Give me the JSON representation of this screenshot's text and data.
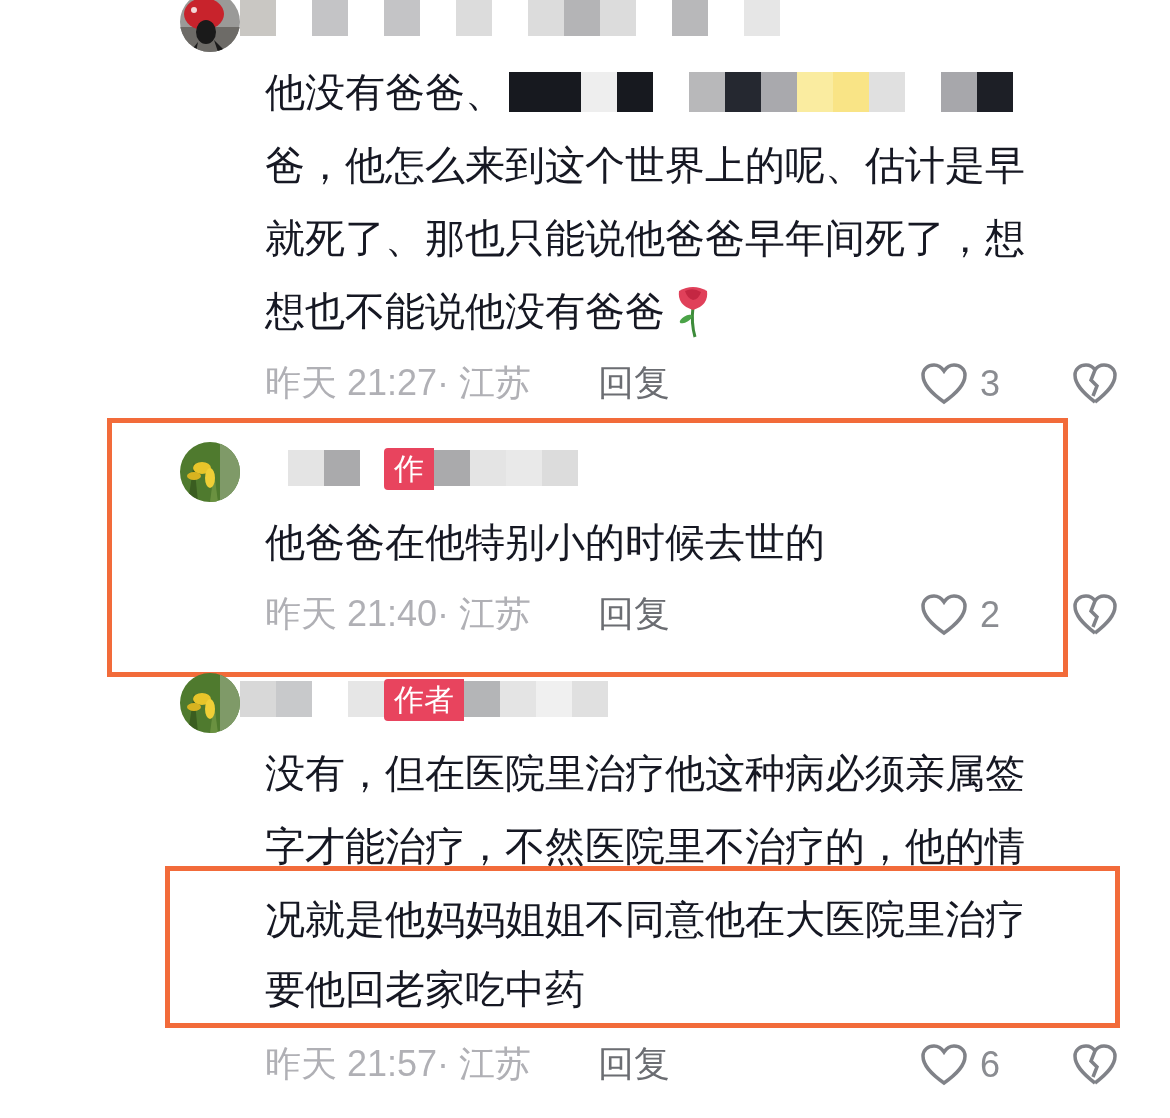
{
  "comments": [
    {
      "highlighted": false,
      "lines": [
        {
          "text": "他没有爸爸、",
          "highlighted": false,
          "kind": "mosaic"
        },
        {
          "text": "爸，他怎么来到这个世界上的呢、估计是早",
          "highlighted": false,
          "kind": "plain"
        },
        {
          "text": "就死了、那也只能说他爸爸早年间死了，想",
          "highlighted": false,
          "kind": "plain"
        },
        {
          "text": "想也不能说他没有爸爸",
          "highlighted": false,
          "kind": "rose"
        }
      ],
      "time": "昨天 21:27· 江苏",
      "reply": "回复",
      "likes": "3"
    },
    {
      "highlighted": true,
      "badge": "作",
      "lines": [
        {
          "text": "他爸爸在他特别小的时候去世的",
          "highlighted": false,
          "kind": "plain"
        }
      ],
      "time": "昨天 21:40· 江苏",
      "reply": "回复",
      "likes": "2"
    },
    {
      "highlighted": false,
      "badge": "作者",
      "lines": [
        {
          "text": "没有，但在医院里治疗他这种病必须亲属签",
          "highlighted": false,
          "kind": "plain"
        },
        {
          "text": "字才能治疗，不然医院里不治疗的，他的情",
          "highlighted": false,
          "kind": "plain"
        },
        {
          "text": "况就是他妈妈姐姐不同意他在大医院里治疗",
          "highlighted": true,
          "kind": "plain"
        },
        {
          "text": "要他回老家吃中药",
          "highlighted": true,
          "kind": "plain"
        }
      ],
      "time": "昨天 21:57· 江苏",
      "reply": "回复",
      "likes": "6"
    }
  ]
}
